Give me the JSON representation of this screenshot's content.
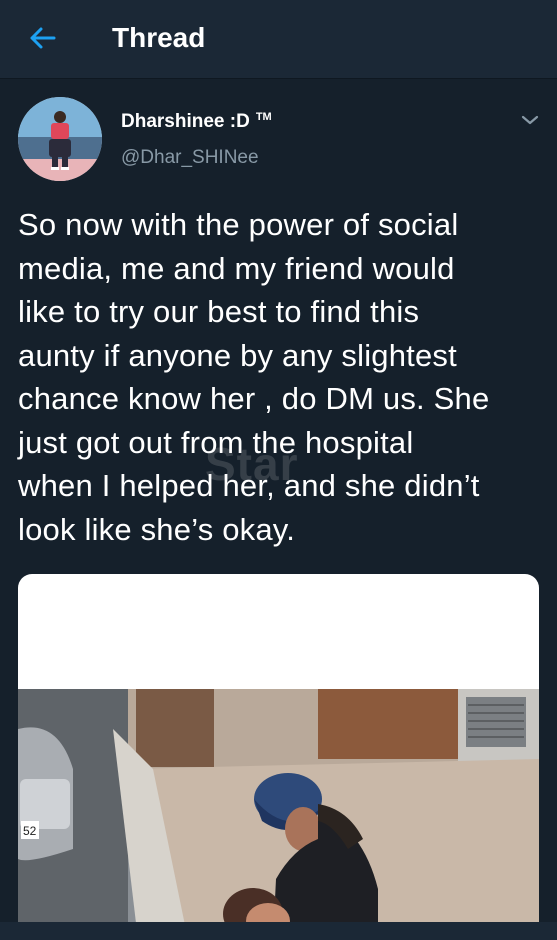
{
  "header": {
    "title": "Thread",
    "back_icon": "back-arrow-icon"
  },
  "tweet": {
    "author_name": "Dharshinee :D",
    "author_tm": "TM",
    "author_handle": "@Dhar_SHINee",
    "text": "So now with the power of social\nmedia, me and my friend would\nlike to try our best to find this\naunty if anyone by any slightest\nchance know her , do DM us. She\njust got out from the hospital\nwhen I helped her, and she didn’t\nlook like she’s okay.",
    "watermark": "Star",
    "media_car_plate": "52"
  },
  "colors": {
    "background": "#15202b",
    "header_bg": "#1b2836",
    "accent": "#1da1f2",
    "secondary_text": "#8899a6"
  }
}
